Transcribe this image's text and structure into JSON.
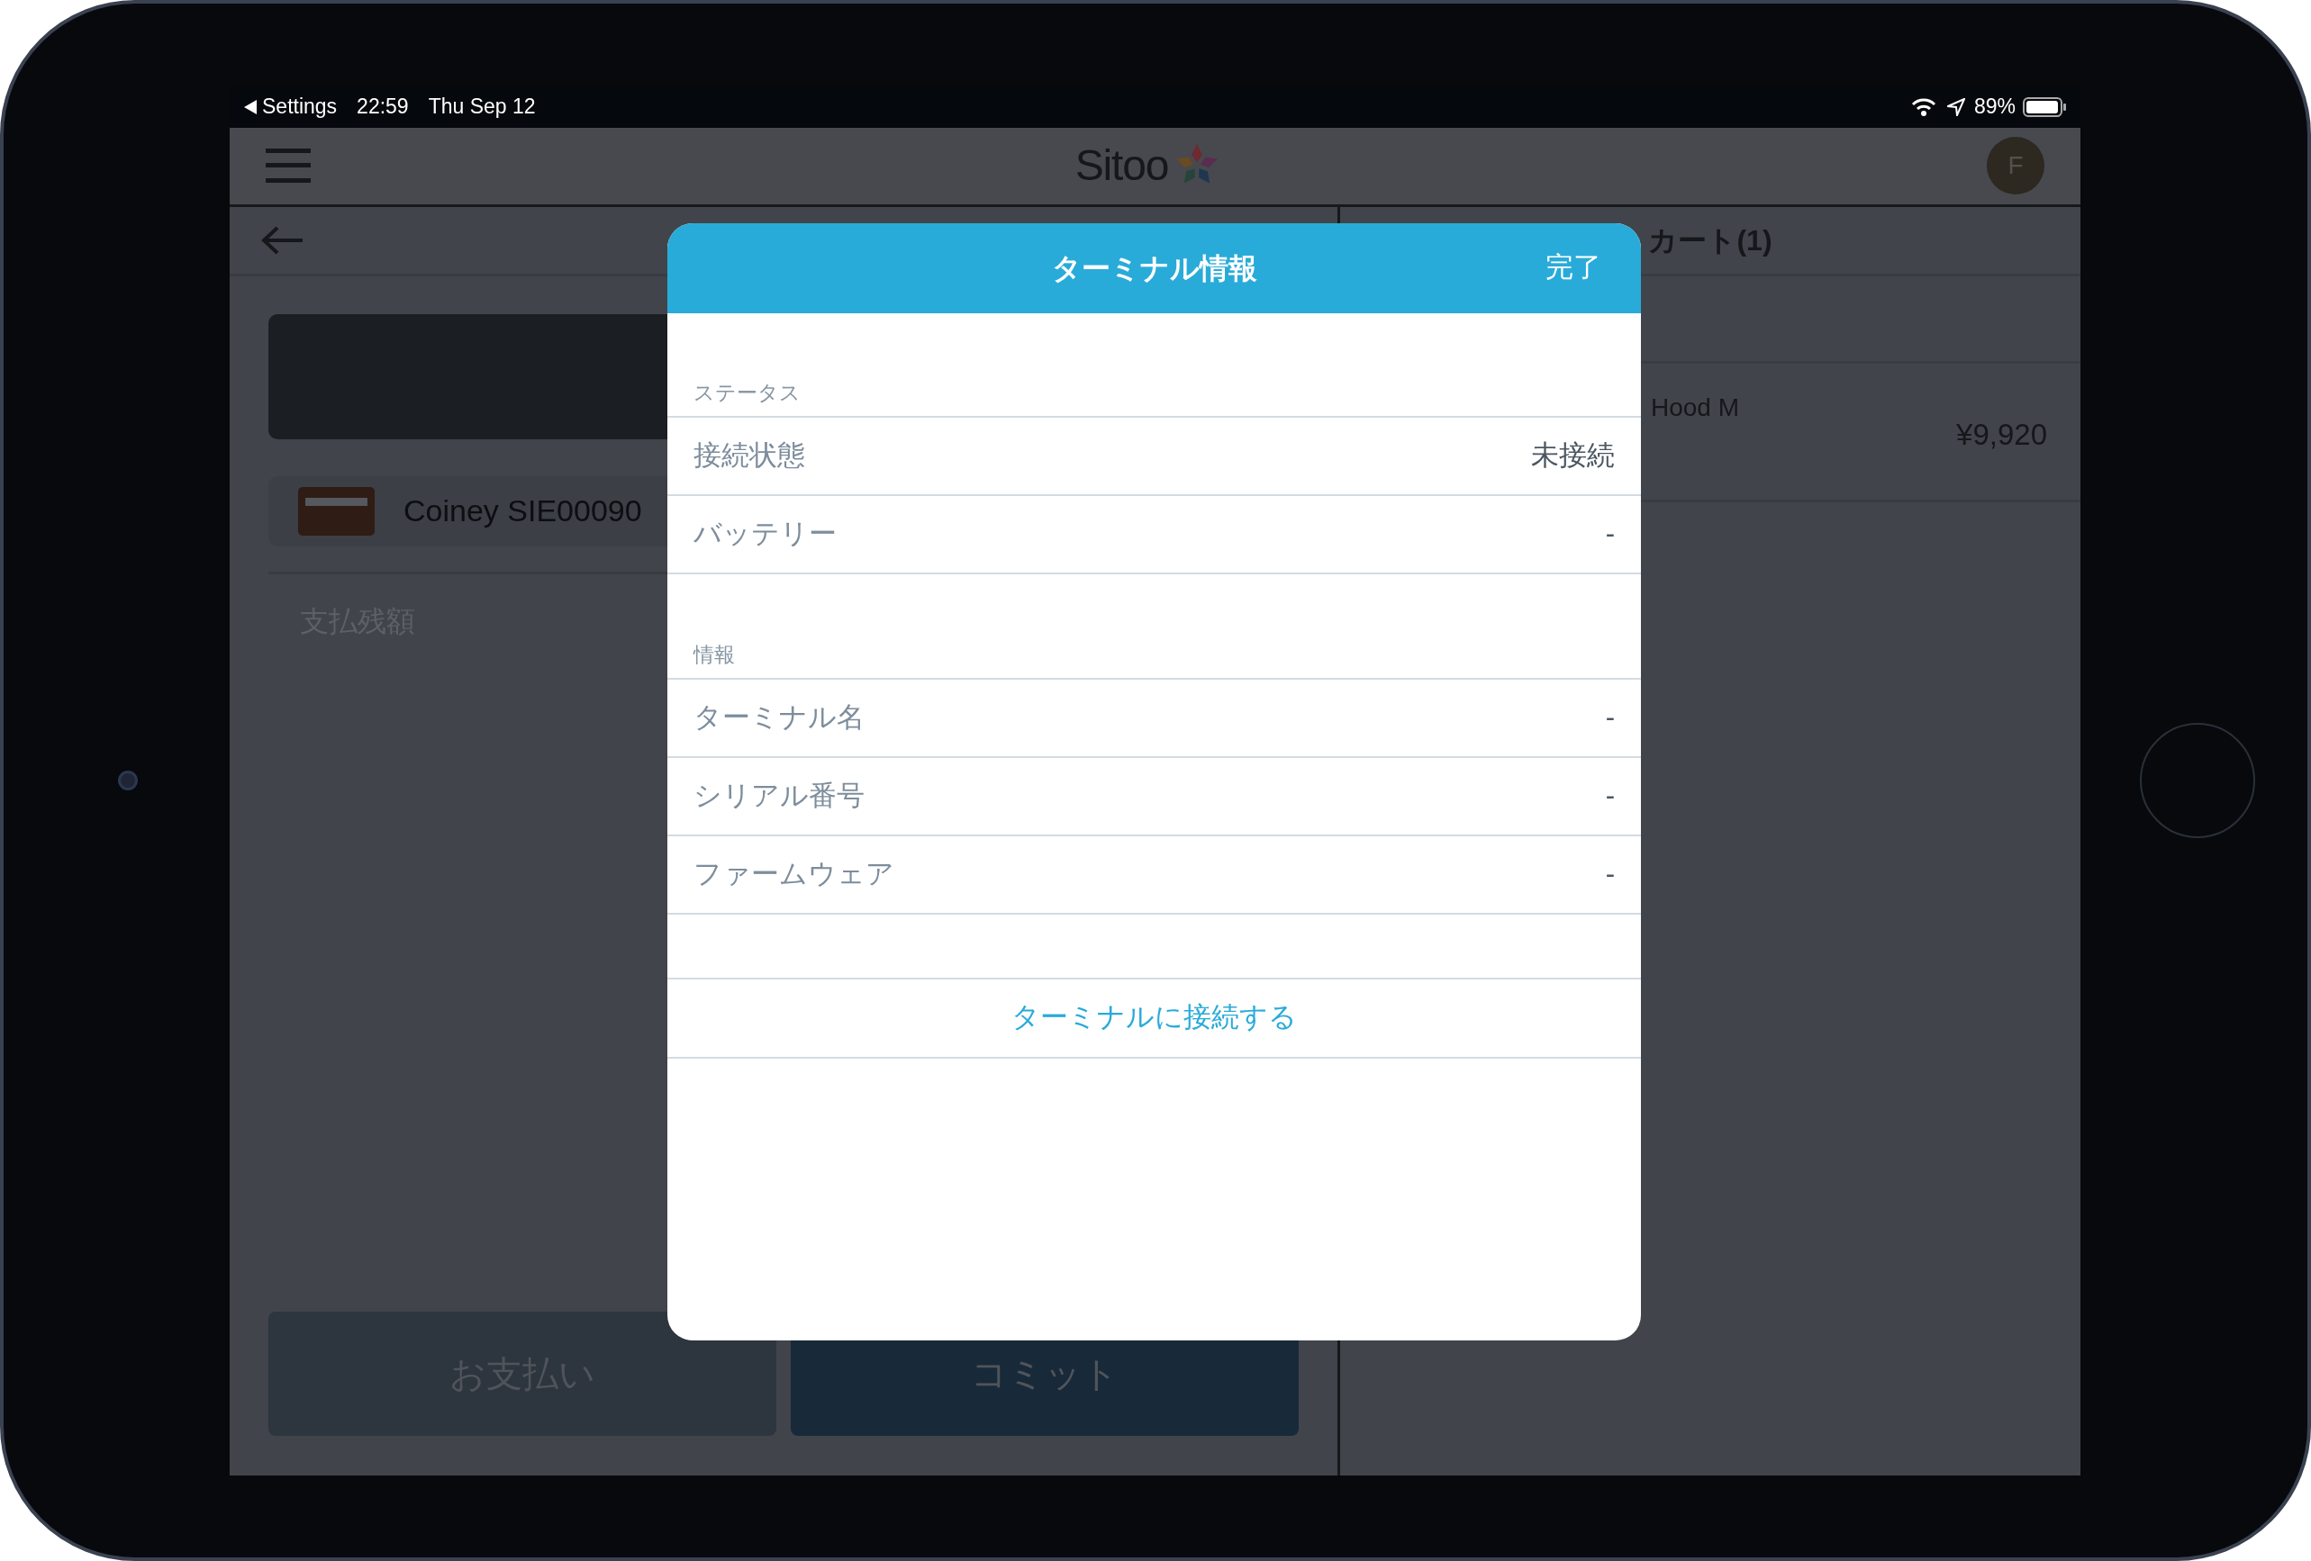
{
  "status_bar": {
    "back_label": "Settings",
    "time": "22:59",
    "date": "Thu Sep 12",
    "battery": "89%"
  },
  "header": {
    "logo": "Sitoo",
    "avatar": "F"
  },
  "payment": {
    "method": "Coiney SIE00090",
    "remaining_label": "支払残額",
    "buttons": [
      "お支払い",
      "コミット"
    ]
  },
  "cart": {
    "title": "カート(1)",
    "items": [
      {
        "name": "Hood M",
        "price": "¥9,920"
      }
    ]
  },
  "modal": {
    "title": "ターミナル情報",
    "done": "完了",
    "sections": [
      {
        "label": "ステータス",
        "rows": [
          {
            "label": "接続状態",
            "value": "未接続"
          },
          {
            "label": "バッテリー",
            "value": "-"
          }
        ]
      },
      {
        "label": "情報",
        "rows": [
          {
            "label": "ターミナル名",
            "value": "-"
          },
          {
            "label": "シリアル番号",
            "value": "-"
          },
          {
            "label": "ファームウェア",
            "value": "-"
          }
        ]
      }
    ],
    "action": "ターミナルに接続する"
  }
}
